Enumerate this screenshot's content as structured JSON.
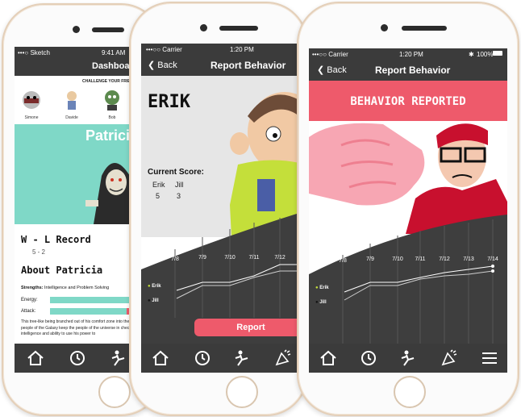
{
  "phone1": {
    "status": {
      "carrier": "•••○ Sketch",
      "time": "9:41 AM"
    },
    "title": "Dashboard",
    "banner": "CHALLENGE YOUR FRIENDS",
    "friends": [
      {
        "name": "Simone"
      },
      {
        "name": "Davide"
      },
      {
        "name": "Bob"
      }
    ],
    "hero_name": "Patricia",
    "record_title": "W - L Record",
    "record_value": "5 - 2",
    "about_title": "About Patricia",
    "strengths_label": "Strengths:",
    "strengths_value": "Intelligence and Problem Solving",
    "energy_label": "Energy:",
    "attack_label": "Attack:",
    "energy_level": 1.0,
    "attack_level": 0.7,
    "bio": "This tree-like being branched out of his comfort zone into the Galaxy. The people of the Galaxy keep the people of the universe in check with his intelligence and ability to use his power to"
  },
  "phone2": {
    "status": {
      "carrier": "•••○○ Carrier",
      "time": "1:20 PM"
    },
    "back": "Back",
    "title": "Report Behavior",
    "hero_name": "ERIK",
    "score_title": "Current Score:",
    "players": [
      "Erik",
      "Jill"
    ],
    "scores": [
      "5",
      "3"
    ],
    "dates": [
      "7/8",
      "7/9",
      "7/10",
      "7/11",
      "7/12"
    ],
    "legend": [
      "Erik",
      "Jill"
    ],
    "report_button": "Report"
  },
  "phone3": {
    "status": {
      "carrier": "•••○○ Carrier",
      "time": "1:20 PM",
      "battery": "100%"
    },
    "back": "Back",
    "title": "Report Behavior",
    "banner": "BEHAVIOR REPORTED",
    "dates": [
      "7/8",
      "7/9",
      "7/10",
      "7/11",
      "7/12",
      "7/13",
      "7/14"
    ],
    "legend": [
      "Erik",
      "Jill"
    ]
  },
  "tabs": [
    "home-icon",
    "history-icon",
    "kick-icon",
    "report-icon",
    "menu-icon"
  ],
  "colors": {
    "dark": "#3b3b3b",
    "red": "#ee5a6b",
    "teal": "#7fd8c7",
    "yellow_bg": "#f6c24a",
    "white": "#ffffff"
  }
}
